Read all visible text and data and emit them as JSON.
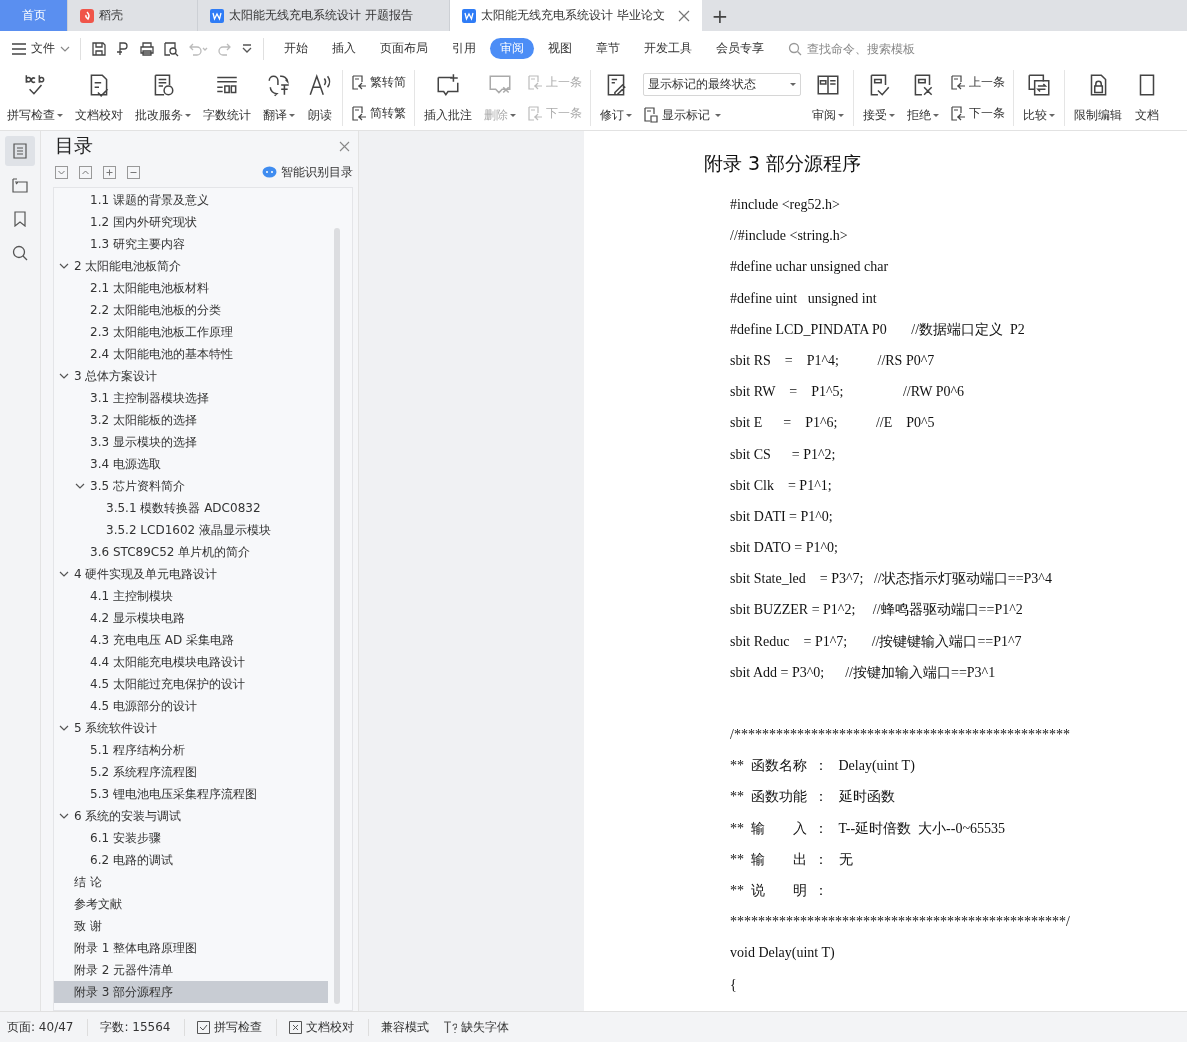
{
  "tabs": [
    {
      "label": "首页",
      "kind": "home",
      "selected": false
    },
    {
      "label": "稻壳",
      "kind": "docer",
      "selected": false
    },
    {
      "label": "太阳能无线充电系统设计 开题报告",
      "kind": "doc",
      "selected": false
    },
    {
      "label": "太阳能无线充电系统设计 毕业论文",
      "kind": "doc",
      "selected": true
    }
  ],
  "new_tab": "+",
  "file_menu": "文件",
  "menu": [
    {
      "label": "开始",
      "selected": false
    },
    {
      "label": "插入",
      "selected": false
    },
    {
      "label": "页面布局",
      "selected": false
    },
    {
      "label": "引用",
      "selected": false
    },
    {
      "label": "审阅",
      "selected": true
    },
    {
      "label": "视图",
      "selected": false
    },
    {
      "label": "章节",
      "selected": false
    },
    {
      "label": "开发工具",
      "selected": false
    },
    {
      "label": "会员专享",
      "selected": false
    }
  ],
  "search": {
    "placeholder": "查找命令、搜索模板"
  },
  "ribbon": [
    {
      "items": [
        {
          "kind": "large",
          "label": "拼写检查",
          "dropdown": true,
          "disabled": false
        },
        {
          "kind": "large",
          "label": "文档校对",
          "dropdown": false,
          "disabled": false
        },
        {
          "kind": "large",
          "label": "批改服务",
          "dropdown": true,
          "disabled": false
        },
        {
          "kind": "large",
          "label": "字数统计",
          "dropdown": false,
          "disabled": false
        },
        {
          "kind": "large",
          "label": "翻译",
          "dropdown": true,
          "disabled": false
        },
        {
          "kind": "large",
          "label": "朗读",
          "dropdown": false,
          "disabled": false
        }
      ]
    },
    {
      "items": [
        {
          "kind": "stack",
          "entries": [
            {
              "label": "繁转简",
              "dropdown": false,
              "disabled": false
            },
            {
              "label": "简转繁",
              "dropdown": false,
              "disabled": false
            }
          ]
        }
      ]
    },
    {
      "items": [
        {
          "kind": "large",
          "label": "插入批注",
          "dropdown": false,
          "disabled": false
        },
        {
          "kind": "large",
          "label": "删除",
          "dropdown": true,
          "disabled": true
        },
        {
          "kind": "stack",
          "entries": [
            {
              "label": "上一条",
              "dropdown": false,
              "disabled": true
            },
            {
              "label": "下一条",
              "dropdown": false,
              "disabled": true
            }
          ]
        }
      ]
    },
    {
      "items": [
        {
          "kind": "large",
          "label": "修订",
          "dropdown": true,
          "disabled": false
        },
        {
          "kind": "select",
          "value": "显示标记的最终状态",
          "entry": {
            "label": "显示标记",
            "dropdown": true,
            "disabled": false
          }
        },
        {
          "kind": "large",
          "label": "审阅",
          "dropdown": true,
          "disabled": false
        }
      ]
    },
    {
      "items": [
        {
          "kind": "large",
          "label": "接受",
          "dropdown": true,
          "disabled": false
        },
        {
          "kind": "large",
          "label": "拒绝",
          "dropdown": true,
          "disabled": false
        },
        {
          "kind": "stack",
          "entries": [
            {
              "label": "上一条",
              "dropdown": false,
              "disabled": false
            },
            {
              "label": "下一条",
              "dropdown": false,
              "disabled": false
            }
          ]
        }
      ]
    },
    {
      "items": [
        {
          "kind": "large",
          "label": "比较",
          "dropdown": true,
          "disabled": false
        }
      ]
    },
    {
      "items": [
        {
          "kind": "large",
          "label": "限制编辑",
          "dropdown": false,
          "disabled": false
        },
        {
          "kind": "large",
          "label": "文档",
          "dropdown": false,
          "disabled": false
        }
      ]
    }
  ],
  "toc": {
    "title": "目录",
    "smart_button": "智能识别目录",
    "items": [
      {
        "children": [
          {
            "label": "1.1 课题的背景及意义",
            "selected": false
          },
          {
            "label": "1.2 国内外研究现状",
            "selected": false
          },
          {
            "label": "1.3 研究主要内容",
            "selected": false
          }
        ]
      },
      {
        "label": "2  太阳能电池板简介",
        "selected": false,
        "expanded": true,
        "children": [
          {
            "label": "2.1 太阳能电池板材料",
            "selected": false
          },
          {
            "label": "2.2 太阳能电池板的分类",
            "selected": false
          },
          {
            "label": "2.3 太阳能电池板工作原理",
            "selected": false
          },
          {
            "label": "2.4 太阳能电池的基本特性",
            "selected": false
          }
        ]
      },
      {
        "label": "3  总体方案设计",
        "selected": false,
        "expanded": true,
        "children": [
          {
            "label": "3.1 主控制器模块选择",
            "selected": false
          },
          {
            "label": "3.2 太阳能板的选择",
            "selected": false
          },
          {
            "label": "3.3 显示模块的选择",
            "selected": false
          },
          {
            "label": "3.4 电源选取",
            "selected": false
          },
          {
            "label": "3.5 芯片资料简介",
            "selected": false,
            "expanded": true,
            "children": [
              {
                "label": "3.5.1 模数转换器 ADC0832",
                "selected": false
              },
              {
                "label": "3.5.2 LCD1602 液晶显示模块",
                "selected": false
              }
            ]
          },
          {
            "label": "3.6 STC89C52 单片机的简介",
            "selected": false
          }
        ]
      },
      {
        "label": "4  硬件实现及单元电路设计",
        "selected": false,
        "expanded": true,
        "children": [
          {
            "label": "4.1 主控制模块",
            "selected": false
          },
          {
            "label": "4.2 显示模块电路",
            "selected": false
          },
          {
            "label": "4.3 充电电压 AD 采集电路",
            "selected": false
          },
          {
            "label": "4.4 太阳能充电模块电路设计",
            "selected": false
          },
          {
            "label": "4.5 太阳能过充电保护的设计",
            "selected": false
          },
          {
            "label": "4.5 电源部分的设计",
            "selected": false
          }
        ]
      },
      {
        "label": "5  系统软件设计",
        "selected": false,
        "expanded": true,
        "children": [
          {
            "label": "5.1 程序结构分析",
            "selected": false
          },
          {
            "label": "5.2 系统程序流程图",
            "selected": false
          },
          {
            "label": "5.3 锂电池电压采集程序流程图",
            "selected": false
          }
        ]
      },
      {
        "label": "6  系统的安装与调试",
        "selected": false,
        "expanded": true,
        "children": [
          {
            "label": "6.1 安装步骤",
            "selected": false
          },
          {
            "label": "6.2 电路的调试",
            "selected": false
          }
        ]
      },
      {
        "label": "结   论",
        "selected": false
      },
      {
        "label": "参考文献",
        "selected": false
      },
      {
        "label": "致   谢",
        "selected": false
      },
      {
        "label": "附录 1 整体电路原理图",
        "selected": false
      },
      {
        "label": "附录 2 元器件清单",
        "selected": false
      },
      {
        "label": "附录 3 部分源程序",
        "selected": true
      }
    ]
  },
  "document": {
    "heading": "附录 3 部分源程序",
    "blocks": [
      {
        "lines": [
          "#include <reg52.h>",
          "//#include <string.h>",
          "#define uchar unsigned char",
          "#define uint   unsigned int",
          "#define LCD_PINDATA P0       //数据端口定义  P2",
          "sbit RS    =    P1^4;           //RS P0^7",
          "sbit RW    =    P1^5;                 //RW P0^6",
          "sbit E      =    P1^6;           //E    P0^5",
          "sbit CS      = P1^2;",
          "sbit Clk    = P1^1;",
          "sbit DATI = P1^0;",
          "sbit DATO = P1^0;",
          "sbit State_led    = P3^7;   //状态指示灯驱动端口==P3^4",
          "sbit BUZZER = P1^2;     //蜂鸣器驱动端口==P1^2",
          "sbit Reduc    = P1^7;       //按键键输入端口==P1^7",
          "sbit Add = P3^0;      //按键加输入端口==P3^1"
        ]
      },
      {
        "lines": [
          "/************************************************",
          "**  函数名称  ：   Delay(uint T)",
          "**  函数功能  ：   延时函数",
          "**  输        入  ：   T--延时倍数  大小--0~65535",
          "**  输        出  ：   无",
          "**  说        明  ：",
          "************************************************/",
          "void Delay(uint T)",
          "{"
        ]
      }
    ]
  },
  "status_bar": [
    {
      "kind": "text",
      "label": "页面: 40/47"
    },
    {
      "kind": "text",
      "label": "字数: 15564"
    },
    {
      "kind": "check",
      "label": "拼写检查"
    },
    {
      "kind": "proof",
      "label": "文档校对"
    },
    {
      "kind": "plain",
      "label": "兼容模式"
    },
    {
      "kind": "font",
      "label": "缺失字体"
    }
  ]
}
